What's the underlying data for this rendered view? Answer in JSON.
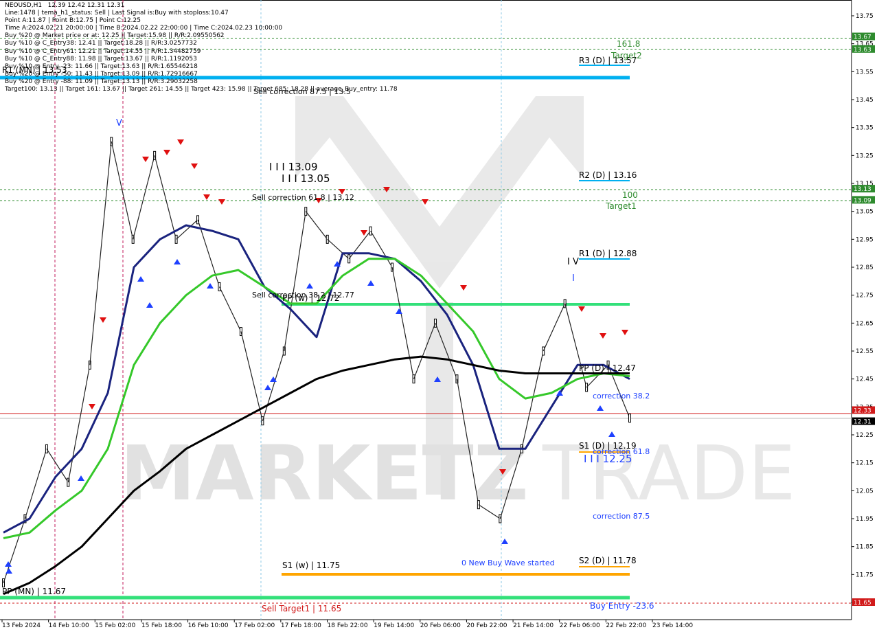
{
  "window": {
    "symbol_line": "NEOUSD,H1   12.39 12.42 12.31 12.31"
  },
  "info_lines": [
    "NEOUSD,H1   12.39 12.42 12.31 12.31",
    "Line:1478 | tema_h1_status: Sell | Last Signal is:Buy with stoploss:10.47",
    "Point A:11.87 | Point B:12.75 | Point C:12.25",
    "Time A:2024.02.21 20:00:00 | Time B:2024.02.22 22:00:00 | Time C:2024.02.23 10:00:00",
    "Buy %20 @ Market price or at: 12.25 || Target:15.98 || R/R:2.09550562",
    "Buy %10 @ C_Entry38: 12.41 || Target:18.28 || R/R:3.0257732",
    "Buy %10 @ C_Entry61: 12.21 || Target:14.55 || R/R:1.34482759",
    "Buy %10 @ C_Entry88: 11.98 || Target:13.67 || R/R:1.1192053",
    "Buy %10 @ Entry -23: 11.66 || Target:13.63 || R/R:1.65546218",
    "Buy %20 @ Entry -50: 11.43 || Target:13.09 || R/R:1.72916667",
    "Buy %20 @ Entry -88: 11.09 || Target:13.13 || R/R:3.29032258",
    "Target100: 13.13 || Target 161: 13.67 || Target 261: 14.55 || Target 423: 15.98 || Target 685: 18.28 || average_Buy_entry: 11.78"
  ],
  "price_axis": {
    "ticks": [
      "13.75",
      "13.65",
      "13.55",
      "13.45",
      "13.35",
      "13.25",
      "13.15",
      "13.05",
      "12.95",
      "12.85",
      "12.75",
      "12.65",
      "12.55",
      "12.45",
      "12.35",
      "12.25",
      "12.15",
      "12.05",
      "11.95",
      "11.85",
      "11.75",
      "11.65"
    ],
    "badges": [
      {
        "label": "13.67",
        "color": "#2e8b2e"
      },
      {
        "label": "13.63",
        "color": "#2e8b2e"
      },
      {
        "label": "13.13",
        "color": "#2e8b2e"
      },
      {
        "label": "13.09",
        "color": "#2e8b2e"
      },
      {
        "label": "12.33",
        "color": "#d11a1a"
      },
      {
        "label": "12.31",
        "color": "#000000"
      },
      {
        "label": "11.65",
        "color": "#d11a1a"
      }
    ]
  },
  "time_axis": [
    "13 Feb 2024",
    "14 Feb 10:00",
    "15 Feb 02:00",
    "15 Feb 18:00",
    "16 Feb 10:00",
    "17 Feb 02:00",
    "17 Feb 18:00",
    "18 Feb 22:00",
    "19 Feb 14:00",
    "20 Feb 06:00",
    "20 Feb 22:00",
    "21 Feb 14:00",
    "22 Feb 06:00",
    "22 Feb 22:00",
    "23 Feb 14:00"
  ],
  "levels": {
    "r3": "R3 (D) | 13.57",
    "r2": "R2 (D) | 13.16",
    "r1": "R1 (D) | 12.88",
    "s1d": "S1 (D) | 12.19",
    "s2d": "S2 (D) | 11.78",
    "s1w": "S1 (w) | 11.75",
    "pp_mn": "PP (MN) | 11.67",
    "r1_mn": "R1 (MN) | 13.53",
    "pp_w": "PP (w) | 12.72",
    "pp_d": "PP (D) | 12.47"
  },
  "annotations": {
    "target161": "161.8",
    "target2": "Target2",
    "target100": "100",
    "target1": "Target1",
    "sell_corr_875": "Sell correction 87.5 | 13.5",
    "sell_corr_618": "Sell correction 61.8 | 13.12",
    "sell_corr_382": "Sell correction 38.2 | 12.77",
    "wave_1309": "I I I 13.09",
    "wave_1305": "I I I 13.05",
    "wave_1225": "I I I 12.25",
    "corr382": "correction 38.2",
    "corr618": "correction 61.8",
    "corr875": "correction 87.5",
    "new_wave": "0 New Buy Wave started",
    "buy_entry": "Buy Entry -23.6",
    "sell_target": "Sell Target1 | 11.65",
    "wave_v_top": "V",
    "wave_iv": "I V",
    "wave_i": "I"
  },
  "watermark": {
    "left": "MARKETZ",
    "right": "TRADE"
  },
  "chart_data": {
    "type": "candlestick",
    "symbol": "NEOUSD",
    "timeframe": "H1",
    "last_bar": {
      "open": 12.39,
      "high": 12.42,
      "low": 12.31,
      "close": 12.31
    },
    "ylim": [
      11.62,
      13.8
    ],
    "price_ticks": [
      13.75,
      13.65,
      13.55,
      13.45,
      13.35,
      13.25,
      13.15,
      13.05,
      12.95,
      12.85,
      12.75,
      12.65,
      12.55,
      12.45,
      12.35,
      12.25,
      12.15,
      12.05,
      11.95,
      11.85,
      11.75,
      11.65
    ],
    "x_ticks": [
      "13 Feb 2024",
      "14 Feb 10:00",
      "15 Feb 02:00",
      "15 Feb 18:00",
      "16 Feb 10:00",
      "17 Feb 02:00",
      "17 Feb 18:00",
      "18 Feb 22:00",
      "19 Feb 14:00",
      "20 Feb 06:00",
      "20 Feb 22:00",
      "21 Feb 14:00",
      "22 Feb 06:00",
      "22 Feb 22:00",
      "23 Feb 14:00"
    ],
    "horizontal_levels": [
      {
        "name": "R3 (D)",
        "value": 13.57
      },
      {
        "name": "R1 (MN)",
        "value": 13.53
      },
      {
        "name": "R2 (D)",
        "value": 13.16
      },
      {
        "name": "R1 (D)",
        "value": 12.88
      },
      {
        "name": "PP (w)",
        "value": 12.72
      },
      {
        "name": "PP (D)",
        "value": 12.47
      },
      {
        "name": "S1 (D)",
        "value": 12.19
      },
      {
        "name": "S2 (D)",
        "value": 11.78
      },
      {
        "name": "S1 (w)",
        "value": 11.75
      },
      {
        "name": "PP (MN)",
        "value": 11.67
      },
      {
        "name": "Target 161.8",
        "value": 13.67
      },
      {
        "name": "Target2",
        "value": 13.63
      },
      {
        "name": "Target 100",
        "value": 13.13
      },
      {
        "name": "Target1",
        "value": 13.09
      },
      {
        "name": "Sell Target1",
        "value": 11.65
      },
      {
        "name": "Bid",
        "value": 12.33
      },
      {
        "name": "Last",
        "value": 12.31
      }
    ],
    "price_path": [
      {
        "x": "13 Feb 2024",
        "y": 11.72
      },
      {
        "x": "13 Feb 2024",
        "y": 11.95
      },
      {
        "x": "14 Feb 10:00",
        "y": 12.2
      },
      {
        "x": "14 Feb 10:00",
        "y": 12.08
      },
      {
        "x": "15 Feb 02:00",
        "y": 12.5
      },
      {
        "x": "15 Feb 02:00",
        "y": 13.3
      },
      {
        "x": "15 Feb 18:00",
        "y": 12.95
      },
      {
        "x": "15 Feb 18:00",
        "y": 13.25
      },
      {
        "x": "16 Feb 10:00",
        "y": 12.95
      },
      {
        "x": "16 Feb 10:00",
        "y": 13.02
      },
      {
        "x": "17 Feb 02:00",
        "y": 12.78
      },
      {
        "x": "17 Feb 02:00",
        "y": 12.62
      },
      {
        "x": "17 Feb 18:00",
        "y": 12.3
      },
      {
        "x": "17 Feb 18:00",
        "y": 12.55
      },
      {
        "x": "18 Feb 22:00",
        "y": 13.05
      },
      {
        "x": "18 Feb 22:00",
        "y": 12.95
      },
      {
        "x": "19 Feb 14:00",
        "y": 12.88
      },
      {
        "x": "19 Feb 14:00",
        "y": 12.98
      },
      {
        "x": "20 Feb 06:00",
        "y": 12.85
      },
      {
        "x": "20 Feb 06:00",
        "y": 12.45
      },
      {
        "x": "20 Feb 22:00",
        "y": 12.65
      },
      {
        "x": "20 Feb 22:00",
        "y": 12.45
      },
      {
        "x": "21 Feb 14:00",
        "y": 12.0
      },
      {
        "x": "21 Feb 14:00",
        "y": 11.95
      },
      {
        "x": "22 Feb 06:00",
        "y": 12.2
      },
      {
        "x": "22 Feb 06:00",
        "y": 12.55
      },
      {
        "x": "22 Feb 22:00",
        "y": 12.72
      },
      {
        "x": "22 Feb 22:00",
        "y": 12.42
      },
      {
        "x": "23 Feb 14:00",
        "y": 12.5
      },
      {
        "x": "23 Feb 14:00",
        "y": 12.31
      }
    ],
    "series": [
      {
        "name": "ma_navy",
        "color": "#1a237e",
        "values": [
          11.9,
          11.95,
          12.1,
          12.2,
          12.4,
          12.85,
          12.95,
          13.0,
          12.98,
          12.95,
          12.78,
          12.7,
          12.6,
          12.9,
          12.9,
          12.88,
          12.8,
          12.68,
          12.5,
          12.2,
          12.2,
          12.35,
          12.5,
          12.5,
          12.45
        ]
      },
      {
        "name": "ma_green",
        "color": "#35c82a",
        "values": [
          11.88,
          11.9,
          11.98,
          12.05,
          12.2,
          12.5,
          12.65,
          12.75,
          12.82,
          12.84,
          12.78,
          12.72,
          12.72,
          12.82,
          12.88,
          12.88,
          12.82,
          12.72,
          12.62,
          12.45,
          12.38,
          12.4,
          12.45,
          12.47,
          12.46
        ]
      },
      {
        "name": "ma_black",
        "color": "#000000",
        "values": [
          11.68,
          11.72,
          11.78,
          11.85,
          11.95,
          12.05,
          12.12,
          12.2,
          12.25,
          12.3,
          12.35,
          12.4,
          12.45,
          12.48,
          12.5,
          12.52,
          12.53,
          12.52,
          12.5,
          12.48,
          12.47,
          12.47,
          12.47,
          12.47,
          12.47
        ]
      }
    ]
  }
}
